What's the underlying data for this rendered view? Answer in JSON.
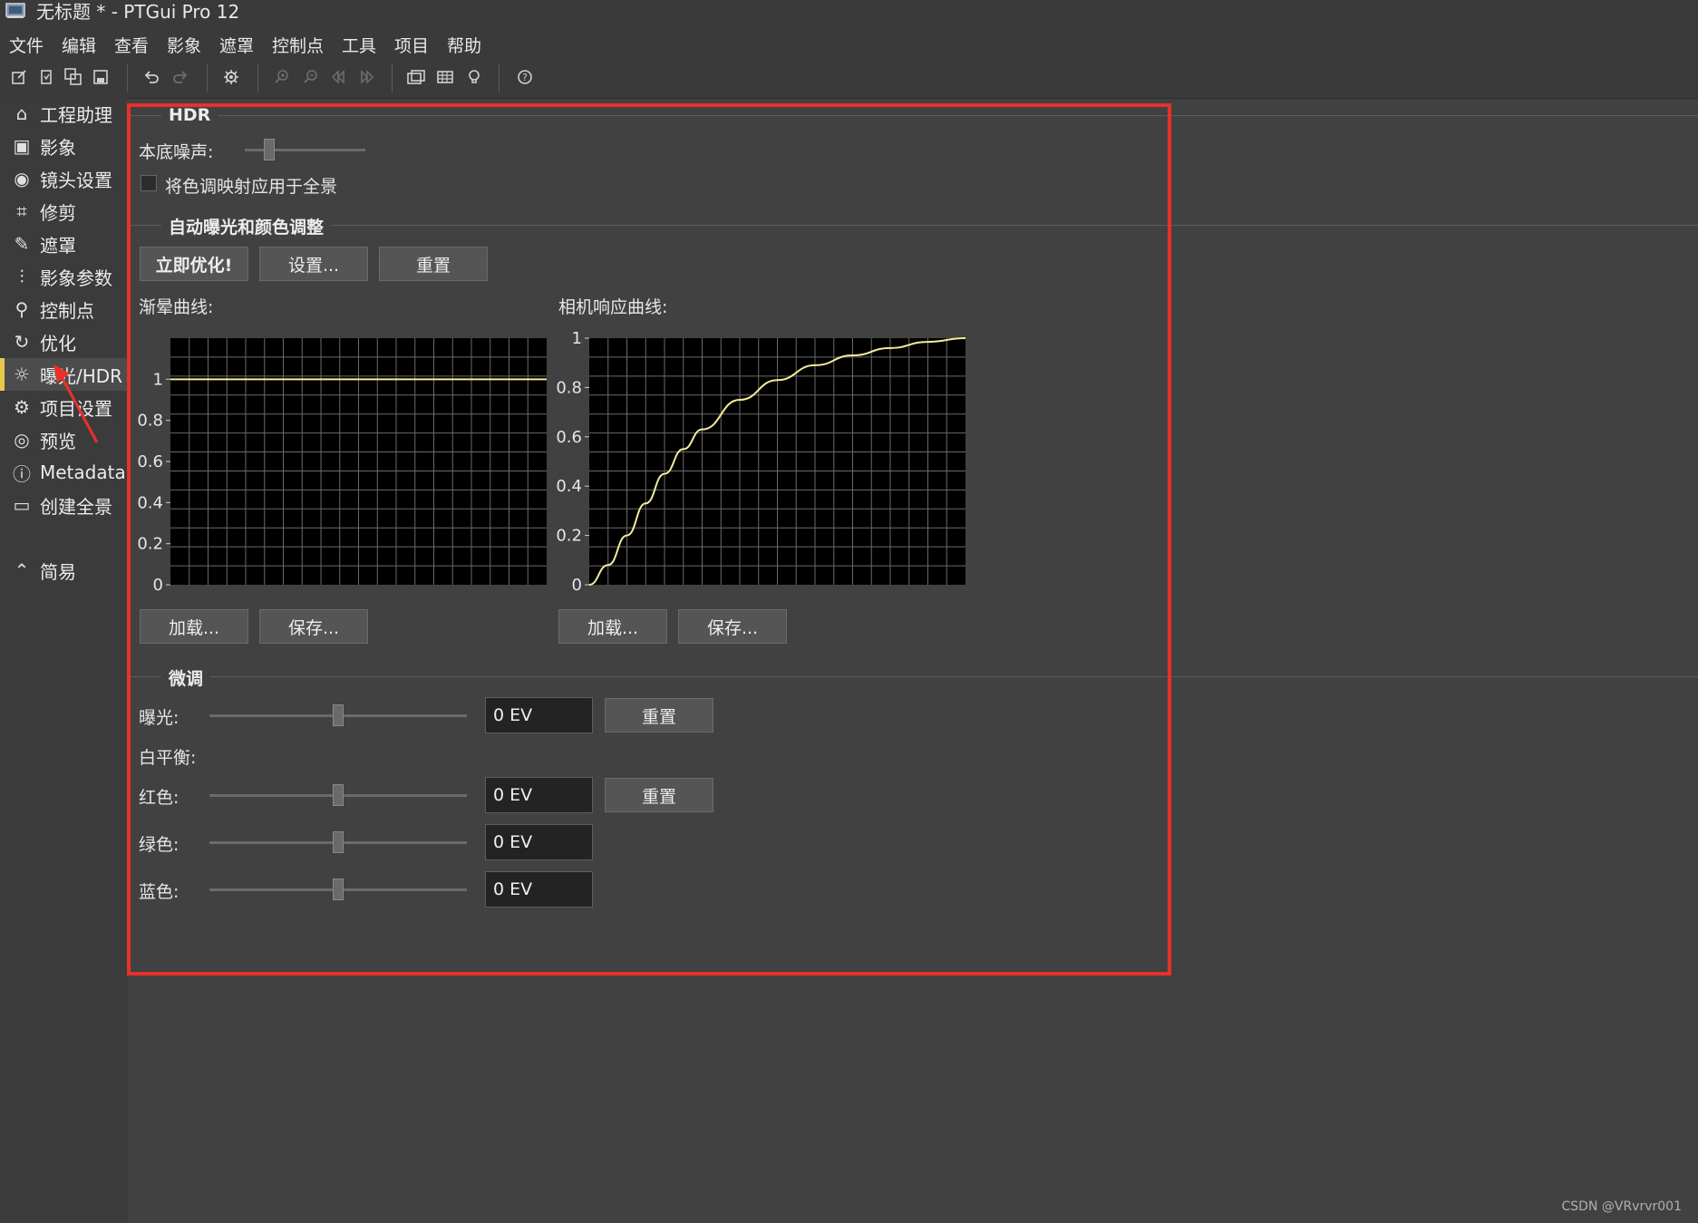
{
  "window": {
    "title": "无标题 * - PTGui Pro 12"
  },
  "menu": [
    "文件",
    "编辑",
    "查看",
    "影象",
    "遮罩",
    "控制点",
    "工具",
    "项目",
    "帮助"
  ],
  "toolbar": {
    "icons": [
      "new-project-icon",
      "open-project-icon",
      "duplicate-icon",
      "save-icon",
      "undo-icon",
      "redo-icon",
      "settings-icon",
      "zoom-in-icon",
      "zoom-out-icon",
      "first-image-icon",
      "last-image-icon",
      "panorama-editor-icon",
      "table-icon",
      "bulb-icon",
      "help-icon"
    ]
  },
  "sidebar": {
    "items": [
      {
        "label": "工程助理",
        "icon": "home-icon",
        "glyph": "⌂"
      },
      {
        "label": "影象",
        "icon": "image-icon",
        "glyph": "▣"
      },
      {
        "label": "镜头设置",
        "icon": "camera-icon",
        "glyph": "◉"
      },
      {
        "label": "修剪",
        "icon": "crop-icon",
        "glyph": "⌗"
      },
      {
        "label": "遮罩",
        "icon": "brush-icon",
        "glyph": "✎"
      },
      {
        "label": "影象参数",
        "icon": "sliders-icon",
        "glyph": "⫶"
      },
      {
        "label": "控制点",
        "icon": "control-points-icon",
        "glyph": "⚲"
      },
      {
        "label": "优化",
        "icon": "optimize-icon",
        "glyph": "↻"
      },
      {
        "label": "曝光/HDR",
        "icon": "sun-icon",
        "glyph": "☼",
        "active": true
      },
      {
        "label": "项目设置",
        "icon": "gear-icon",
        "glyph": "⚙"
      },
      {
        "label": "预览",
        "icon": "eye-icon",
        "glyph": "◎"
      },
      {
        "label": "Metadata",
        "icon": "info-icon",
        "glyph": "ⓘ"
      },
      {
        "label": "创建全景",
        "icon": "panorama-icon",
        "glyph": "▭"
      }
    ],
    "simple": {
      "label": "简易",
      "icon": "chevron-up-circle-icon",
      "glyph": "⌃"
    }
  },
  "hdr": {
    "title": "HDR",
    "noise_label": "本底噪声:",
    "tonemap_label": "将色调映射应用于全景",
    "tonemap_checked": false
  },
  "auto": {
    "title": "自动曝光和颜色调整",
    "optimize_label": "立即优化!",
    "settings_label": "设置...",
    "reset_label": "重置",
    "vignetting_label": "渐晕曲线:",
    "response_label": "相机响应曲线:",
    "load_label": "加载...",
    "save_label": "保存..."
  },
  "fine": {
    "title": "微调",
    "exposure_label": "曝光:",
    "exposure_value": "0 EV",
    "reset_label": "重置",
    "white_balance_label": "白平衡:",
    "red_label": "红色:",
    "red_value": "0 EV",
    "green_label": "绿色:",
    "green_value": "0 EV",
    "blue_label": "蓝色:",
    "blue_value": "0 EV"
  },
  "sliders": {
    "noise": 0.2,
    "exposure": 0.5,
    "red": 0.5,
    "green": 0.5,
    "blue": 0.5
  },
  "chart_data": [
    {
      "type": "line",
      "title": "渐晕曲线:",
      "yticks": [
        "1",
        "0.8",
        "0.6",
        "0.4",
        "0.2",
        "0"
      ],
      "ylim": [
        0,
        1.2
      ],
      "xlim": [
        0,
        1
      ],
      "grid": true,
      "series": [
        {
          "x": [
            0,
            1
          ],
          "y": [
            1,
            1
          ]
        }
      ]
    },
    {
      "type": "line",
      "title": "相机响应曲线:",
      "yticks": [
        "1",
        "0.8",
        "0.6",
        "0.4",
        "0.2",
        "0"
      ],
      "ylim": [
        0,
        1
      ],
      "xlim": [
        0,
        1
      ],
      "grid": true,
      "series": [
        {
          "x": [
            0,
            0.05,
            0.1,
            0.15,
            0.2,
            0.25,
            0.3,
            0.4,
            0.5,
            0.6,
            0.7,
            0.8,
            0.9,
            1.0
          ],
          "y": [
            0,
            0.08,
            0.2,
            0.33,
            0.45,
            0.55,
            0.63,
            0.75,
            0.83,
            0.89,
            0.93,
            0.96,
            0.985,
            1.0
          ]
        }
      ]
    }
  ],
  "watermark": "CSDN @VRvrvr001"
}
